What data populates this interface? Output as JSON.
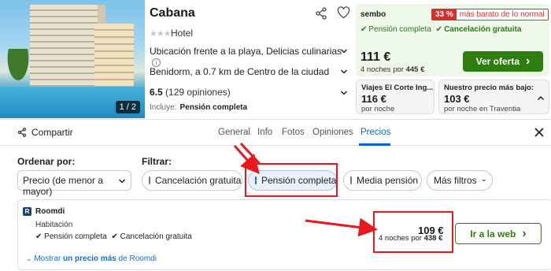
{
  "hotel": {
    "name": "Cabana",
    "type": "Hotel",
    "stars": "★★★",
    "photo_counter": "1 / 2",
    "feature_row": "Ubicación frente a la playa, Delicias culinarias",
    "location_row": "Benidorm, a 0.7 km de Centro de la ciudad",
    "rating": "6.5",
    "opinions": "(129 opiniones)",
    "includes_label": "Incluye:",
    "includes_value": "Pensión completa"
  },
  "top_deal": {
    "provider": "sembo",
    "badge_pct": "33 %",
    "badge_text": "más barato de lo normal",
    "features": [
      "Pensión completa",
      "Cancelación gratuita"
    ],
    "check": "✔",
    "price": "111 €",
    "nights_text": "4 noches por",
    "total": "445 €",
    "button": "Ver oferta",
    "button_arrow": "›"
  },
  "alt_deals": [
    {
      "provider": "Viajes El Corte Ing...",
      "price": "116 €",
      "sub": "por noche"
    },
    {
      "provider": "Nuestro precio más bajo:",
      "price": "103 €",
      "sub": "por noche en Traventia"
    }
  ],
  "tabbar": {
    "share": "Compartir",
    "tabs": [
      "General",
      "Info",
      "Fotos",
      "Opiniones",
      "Precios"
    ],
    "active": "Precios"
  },
  "filters": {
    "sort_label": "Ordenar por:",
    "sort_value": "Precio (de menor a mayor)",
    "filter_label": "Filtrar:",
    "chips": [
      {
        "label": "Cancelación gratuita",
        "checked": false
      },
      {
        "label": "Pensión completa",
        "checked": true
      },
      {
        "label": "Media pensión",
        "checked": false
      }
    ],
    "more": "Más filtros"
  },
  "offer": {
    "logo_letter": "R",
    "provider": "Roomdi",
    "room": "Habitación",
    "features": [
      "Pensión completa",
      "Cancelación gratuita"
    ],
    "price": "109 €",
    "nights_text": "4 noches por",
    "total": "438 €",
    "button": "Ir a la web",
    "button_arrow": "›",
    "more_prefix": "Mostrar",
    "more_bold": "un precio más",
    "more_suffix": "de Roomdi"
  },
  "colors": {
    "green_button": "#2f7d0e",
    "deal_bg": "#eef8e9",
    "accent_blue": "#0b67c9",
    "annotation_red": "#e6191e"
  }
}
